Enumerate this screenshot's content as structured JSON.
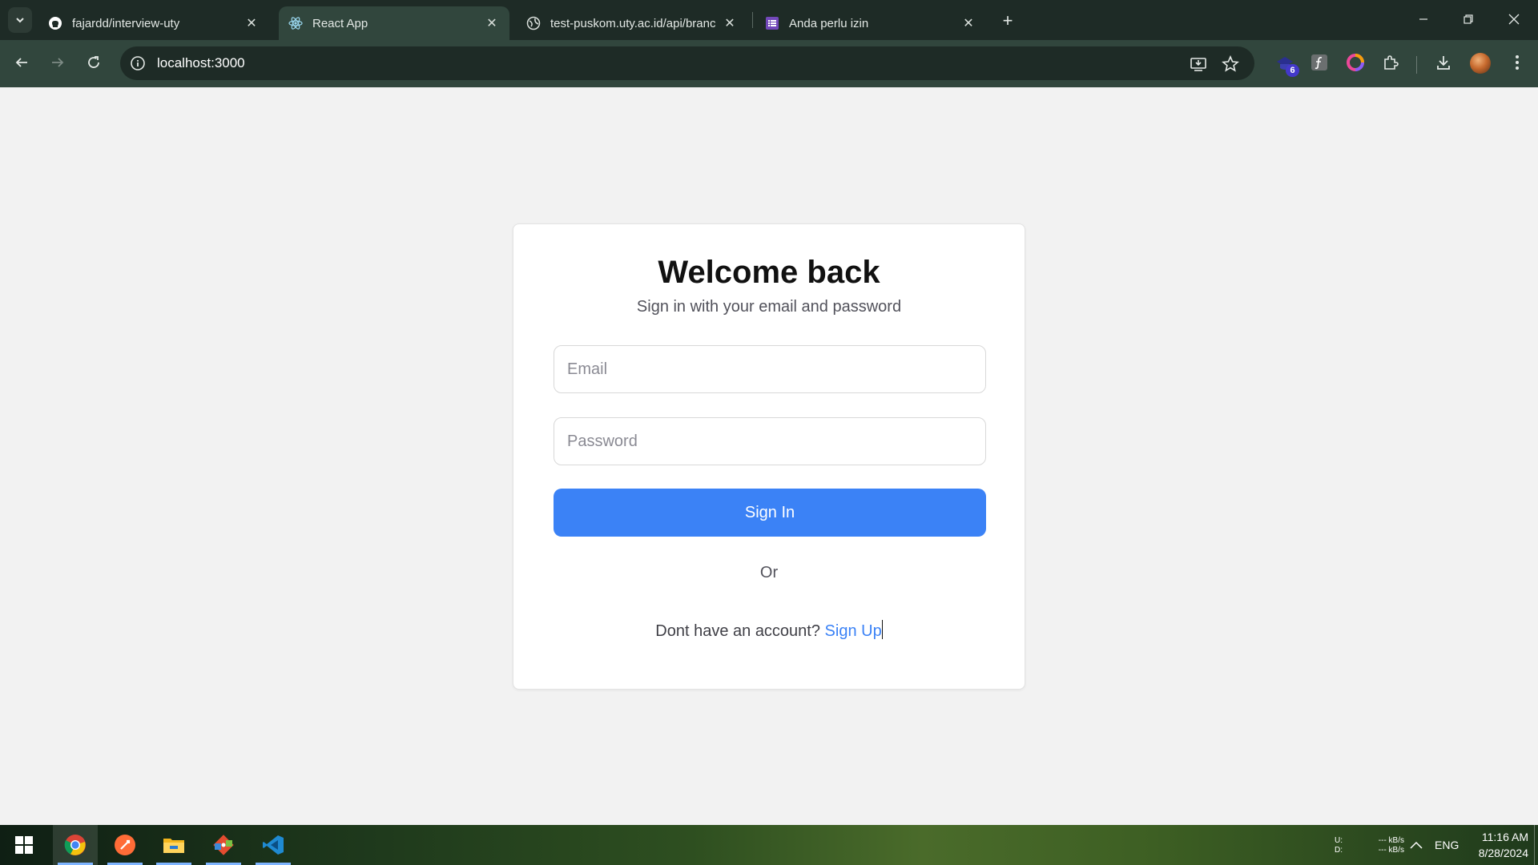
{
  "browser": {
    "tabs": [
      {
        "title": "fajardd/interview-uty",
        "icon": "github-icon"
      },
      {
        "title": "React App",
        "icon": "react-icon"
      },
      {
        "title": "test-puskom.uty.ac.id/api/branc",
        "icon": "globe-icon"
      },
      {
        "title": "Anda perlu izin",
        "icon": "form-icon"
      }
    ],
    "active_tab_index": 1,
    "address": "localhost:3000",
    "extension_badge": "6"
  },
  "login": {
    "title": "Welcome back",
    "subtitle": "Sign in with your email and password",
    "email_placeholder": "Email",
    "password_placeholder": "Password",
    "signin_label": "Sign In",
    "or_label": "Or",
    "no_account_text": "Dont have an account?",
    "signup_label": "Sign Up"
  },
  "taskbar": {
    "apps": [
      "windows-start-icon",
      "chrome-icon",
      "postman-icon",
      "file-explorer-icon",
      "git-icon",
      "vscode-icon"
    ],
    "active_app": "chrome-icon",
    "net_labels": {
      "up": "U:",
      "down": "D:",
      "up_speed": "--- kB/s",
      "down_speed": "--- kB/s"
    },
    "language": "ENG",
    "time": "11:16 AM",
    "date": "8/28/2024"
  },
  "colors": {
    "primary": "#3b82f6",
    "page_bg": "#f2f2f2",
    "chrome_dark": "#1e2b26",
    "chrome_toolbar": "#31463d"
  }
}
